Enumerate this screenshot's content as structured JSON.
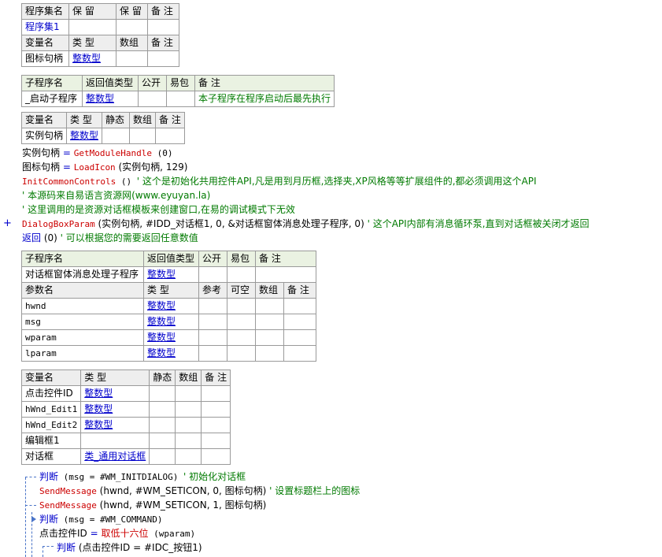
{
  "assembly_table": {
    "headers": [
      "程序集名",
      "保 留",
      "保 留",
      "备 注"
    ],
    "row": [
      "程序集1",
      "",
      "",
      ""
    ],
    "var_headers": [
      "变量名",
      "类 型",
      "数组",
      "备 注"
    ],
    "var_row": [
      "图标句柄",
      "整数型",
      "",
      ""
    ]
  },
  "sub_start": {
    "headers": [
      "子程序名",
      "返回值类型",
      "公开",
      "易包",
      "备 注"
    ],
    "row": [
      "_启动子程序",
      "整数型",
      "",
      "",
      "本子程序在程序启动后最先执行"
    ],
    "var_headers": [
      "变量名",
      "类 型",
      "静态",
      "数组",
      "备 注"
    ],
    "var_row": [
      "实例句柄",
      "整数型",
      "",
      "",
      ""
    ]
  },
  "code1": [
    {
      "a": "实例句柄",
      "op": " = ",
      "fn": "GetModuleHandle",
      "args": " (0)"
    },
    {
      "a": "图标句柄",
      "op": " = ",
      "fn": "LoadIcon",
      "args": " (实例句柄, 129)"
    },
    {
      "fn": "InitCommonControls",
      "args": " () ",
      "cmt": "' 这个是初始化共用控件API,凡是用到月历框,选择夹,XP风格等等扩展组件的,都必须调用这个API"
    },
    {
      "cmt": "' 本源码来自易语言资源网(www.eyuyan.la)"
    },
    {
      "cmt": "' 这里调用的是资源对话框模板来创建窗口,在易的调试模式下无效"
    },
    {
      "fn": "DialogBoxParam",
      "args": " (实例句柄, #IDD_对话框1, 0, &对话框窗体消息处理子程序, 0) ",
      "cmt": "' 这个API内部有消息循环泵,直到对话框被关闭才返回"
    },
    {
      "kw": "返回",
      "args": " (0) ",
      "cmt": "' 可以根据您的需要返回任意数值"
    }
  ],
  "plus_symbol": "+",
  "sub_dialog": {
    "headers": [
      "子程序名",
      "返回值类型",
      "公开",
      "易包",
      "备 注"
    ],
    "row": [
      "对话框窗体消息处理子程序",
      "整数型",
      "",
      "",
      ""
    ],
    "param_headers": [
      "参数名",
      "类 型",
      "参考",
      "可空",
      "数组",
      "备 注"
    ],
    "params": [
      [
        "hwnd",
        "整数型"
      ],
      [
        "msg",
        "整数型"
      ],
      [
        "wparam",
        "整数型"
      ],
      [
        "lparam",
        "整数型"
      ]
    ],
    "var_headers": [
      "变量名",
      "类 型",
      "静态",
      "数组",
      "备 注"
    ],
    "vars": [
      [
        "点击控件ID",
        "整数型"
      ],
      [
        "hWnd_Edit1",
        "整数型"
      ],
      [
        "hWnd_Edit2",
        "整数型"
      ],
      [
        "编辑框1",
        ""
      ],
      [
        "对话框",
        "类_通用对话框"
      ]
    ]
  },
  "code2": [
    {
      "kw": "判断",
      "args": " (msg = #WM_INITDIALOG) ",
      "cmt": "' 初始化对话框"
    },
    {
      "fn": "SendMessage",
      "args": " (hwnd, #WM_SETICON, 0, 图标句柄) ",
      "cmt": "' 设置标题栏上的图标"
    },
    {
      "fn": "SendMessage",
      "args": " (hwnd, #WM_SETICON, 1, 图标句柄)"
    },
    {
      "kw": "判断",
      "args": " (msg = #WM_COMMAND)"
    },
    {
      "a": "点击控件ID",
      "op": " = ",
      "fn": "取低十六位",
      "args": " (wparam)"
    },
    {
      "kw": "判断",
      "args": " (点击控件ID = #IDC_按钮1)"
    }
  ]
}
